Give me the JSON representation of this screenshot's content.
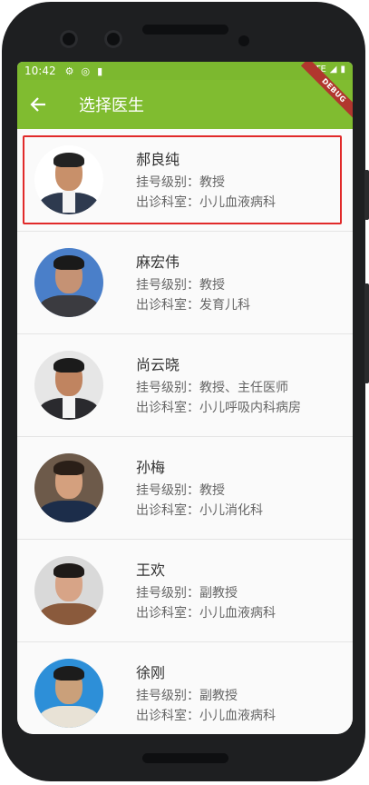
{
  "status_bar": {
    "time": "10:42",
    "network": "LTE",
    "icons": [
      "gear-icon",
      "vpn-icon",
      "sim-card-icon",
      "signal-icon",
      "battery-icon"
    ]
  },
  "app_bar": {
    "title": "选择医生",
    "back_icon": "arrow-left-icon",
    "debug_banner": "DEBUG"
  },
  "doctors": [
    {
      "name": "郝良纯",
      "level_label": "挂号级别：",
      "level": "教授",
      "dept_label": "出诊科室：",
      "dept": "小儿血液病科",
      "selected": true
    },
    {
      "name": "麻宏伟",
      "level_label": "挂号级别：",
      "level": "教授",
      "dept_label": "出诊科室：",
      "dept": "发育儿科",
      "selected": false
    },
    {
      "name": "尚云晓",
      "level_label": "挂号级别：",
      "level": "教授、主任医师",
      "dept_label": "出诊科室：",
      "dept": "小儿呼吸内科病房",
      "selected": false
    },
    {
      "name": "孙梅",
      "level_label": "挂号级别：",
      "level": "教授",
      "dept_label": "出诊科室：",
      "dept": "小儿消化科",
      "selected": false
    },
    {
      "name": "王欢",
      "level_label": "挂号级别：",
      "level": "副教授",
      "dept_label": "出诊科室：",
      "dept": "小儿血液病科",
      "selected": false
    },
    {
      "name": "徐刚",
      "level_label": "挂号级别：",
      "level": "副教授",
      "dept_label": "出诊科室：",
      "dept": "小儿血液病科",
      "selected": false
    }
  ],
  "colors": {
    "app_bar": "#80bc30",
    "status_bar": "#7cb82f",
    "selection_border": "#e12a2a"
  }
}
